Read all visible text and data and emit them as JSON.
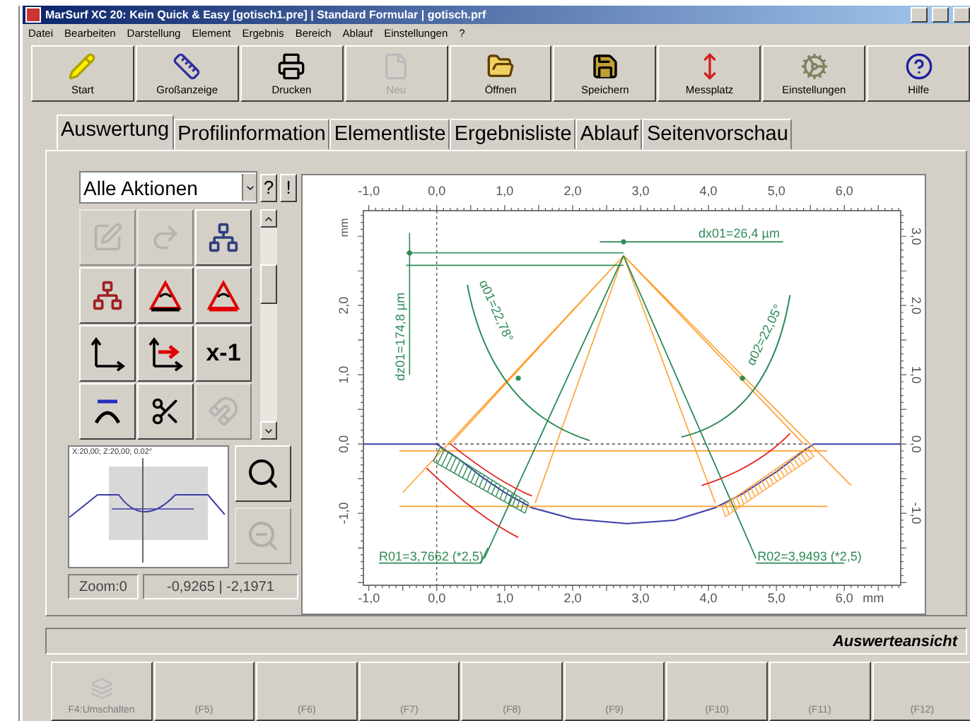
{
  "window": {
    "title": "MarSurf XC 20: Kein Quick & Easy [gotisch1.pre] | Standard Formular | gotisch.prf"
  },
  "menu": [
    "Datei",
    "Bearbeiten",
    "Darstellung",
    "Element",
    "Ergebnis",
    "Bereich",
    "Ablauf",
    "Einstellungen",
    "?"
  ],
  "toolbar": [
    {
      "label": "Start",
      "disabled": false
    },
    {
      "label": "Großanzeige",
      "disabled": false
    },
    {
      "label": "Drucken",
      "disabled": false
    },
    {
      "label": "Neu",
      "disabled": true
    },
    {
      "label": "Öffnen",
      "disabled": false
    },
    {
      "label": "Speichern",
      "disabled": false
    },
    {
      "label": "Messplatz",
      "disabled": false
    },
    {
      "label": "Einstellungen",
      "disabled": false
    },
    {
      "label": "Hilfe",
      "disabled": false
    }
  ],
  "tabs": [
    {
      "label": "Auswertung",
      "selected": true
    },
    {
      "label": "Profilinformation",
      "selected": false
    },
    {
      "label": "Elementliste",
      "selected": false
    },
    {
      "label": "Ergebnisliste",
      "selected": false
    },
    {
      "label": "Ablauf",
      "selected": false
    },
    {
      "label": "Seitenvorschau",
      "selected": false
    }
  ],
  "actions": {
    "filter": "Alle Aktionen",
    "help_button": "?",
    "info_button": "!",
    "items": [
      {
        "disabled": true
      },
      {
        "disabled": true
      },
      {
        "disabled": false
      },
      {
        "disabled": false
      },
      {
        "disabled": false
      },
      {
        "disabled": false
      },
      {
        "disabled": false
      },
      {
        "disabled": false
      },
      {
        "disabled": false,
        "glyph": "x-1"
      },
      {
        "disabled": false
      },
      {
        "disabled": false
      },
      {
        "disabled": true
      }
    ]
  },
  "preview": {
    "caption": "X:20,00; Z:20,00; 0,02°"
  },
  "zoom_buttons": [
    {
      "disabled": false
    },
    {
      "disabled": true
    }
  ],
  "status_fields": [
    "Zoom:0",
    "-0,9265 | -2,1971"
  ],
  "chart": {
    "chart_data": {
      "type": "line",
      "xlabel": "mm",
      "ylabel": "mm",
      "xlim": [
        -1.08,
        6.83
      ],
      "ylim": [
        -2.04,
        3.37
      ],
      "x": [
        -1.08,
        0,
        0.3,
        0.7,
        1.0,
        1.4,
        2.0,
        2.8,
        3.5,
        4.1,
        4.5,
        5.0,
        5.4,
        5.55,
        6.83
      ],
      "series": [
        {
          "color": "#3c3ca8",
          "values": [
            0,
            0,
            -0.2,
            -0.5,
            -0.7,
            -0.92,
            -1.08,
            -1.15,
            -1.1,
            -0.92,
            -0.72,
            -0.4,
            -0.1,
            0,
            0
          ]
        }
      ],
      "xticks": [
        {
          "value": -1,
          "label": "-1,0"
        },
        {
          "value": 0,
          "label": "0,0"
        },
        {
          "value": 1,
          "label": "1,0"
        },
        {
          "value": 2,
          "label": "2,0"
        },
        {
          "value": 3,
          "label": "3,0"
        },
        {
          "value": 4,
          "label": "4,0"
        },
        {
          "value": 5,
          "label": "5,0"
        },
        {
          "value": 6,
          "label": "6,0"
        }
      ],
      "yticks": [
        {
          "value": 2,
          "label": "2,0"
        },
        {
          "value": 1,
          "label": "1,0"
        },
        {
          "value": 0,
          "label": "0,0"
        },
        {
          "value": -1,
          "label": "-1,0"
        }
      ],
      "annotations": [
        {
          "text": "dx01=26,4 µm"
        },
        {
          "text": "dz01=174,8 µm"
        },
        {
          "text": "α01=22,78°"
        },
        {
          "text": "α02=22,05°"
        },
        {
          "text": "R01=3,7662 (*2,5)"
        },
        {
          "text": "R02=3,9493 (*2,5)"
        }
      ]
    },
    "top_tick_labels": [
      "-1,0",
      "0,0",
      "1,0",
      "2,0",
      "3,0",
      "4,0",
      "5,0",
      "6,0"
    ],
    "right_tick_labels": [
      "3,0",
      "2,0",
      "1,0",
      "0,0",
      "-1,0"
    ]
  },
  "view_status": "Auswerteansicht",
  "function_keys": [
    {
      "label": "F4:Umschalten",
      "disabled": true
    },
    {
      "label": "(F5)",
      "disabled": true
    },
    {
      "label": "(F6)",
      "disabled": true
    },
    {
      "label": "(F7)",
      "disabled": true
    },
    {
      "label": "(F8)",
      "disabled": true
    },
    {
      "label": "(F9)",
      "disabled": true
    },
    {
      "label": "(F10)",
      "disabled": true
    },
    {
      "label": "(F11)",
      "disabled": true
    },
    {
      "label": "(F12)",
      "disabled": true
    }
  ]
}
